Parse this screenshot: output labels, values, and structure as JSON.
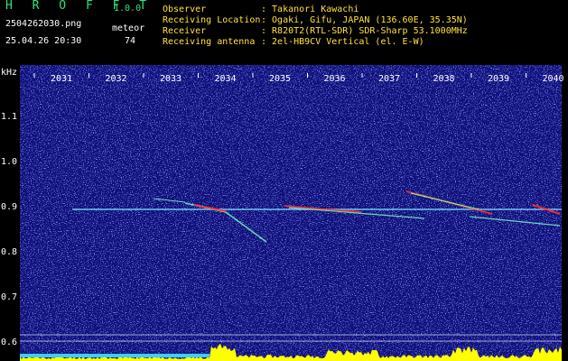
{
  "app": {
    "title": "H R O F F T",
    "version": "1.0.0"
  },
  "file": {
    "name": "2504262030.png",
    "datetime": "25.04.26 20:30"
  },
  "meteor": {
    "label": "meteor",
    "count": "74"
  },
  "station": [
    {
      "key": "Observer",
      "value": ": Takanori Kawachi"
    },
    {
      "key": "Receiving Location",
      "value": ": Ogaki, Gifu, JAPAN (136.60E, 35.35N)"
    },
    {
      "key": "Receiver",
      "value": ": R820T2(RTL-SDR) SDR-Sharp 53.1000MHz"
    },
    {
      "key": "Receiving antenna",
      "value": ": 2el-HB9CV Vertical (el. E-W)"
    }
  ],
  "spectrogram": {
    "unit": "kHz",
    "time_labels": [
      "2031",
      "2032",
      "2033",
      "2034",
      "2035",
      "2036",
      "2037",
      "2038",
      "2039",
      "2040"
    ],
    "freq_labels": [
      "1.1",
      "1.0",
      "0.9",
      "0.8",
      "0.7",
      "0.6"
    ],
    "colors": {
      "background": "#10107a",
      "noise": "#3a4cf0",
      "carrier": "#7fd7ff",
      "meteor_hot": "#ff3030",
      "activity_bar": "#ffff00",
      "axis_text": "#ffffff"
    }
  }
}
